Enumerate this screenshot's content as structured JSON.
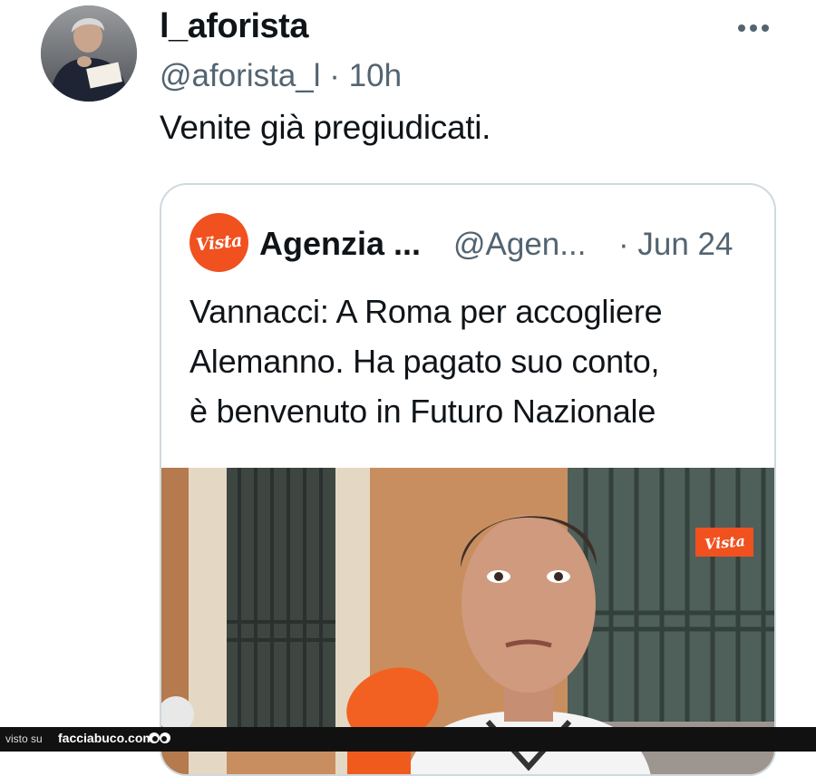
{
  "tweet": {
    "author_name": "l_aforista",
    "author_handle": "@aforista_l",
    "separator": "·",
    "time": "10h",
    "text": "Venite già pregiudicati."
  },
  "quoted_tweet": {
    "avatar_label": "Vista",
    "author_name": "Agenzia ...",
    "author_handle": "@Agen...",
    "date": "· Jun 24",
    "text_lines": [
      "Vannacci: A Roma per accogliere",
      "Alemanno. Ha pagato suo conto,",
      "è benvenuto in Futuro Nazionale"
    ],
    "media_watermark": "Vista"
  },
  "footer": {
    "prefix": "visto su",
    "brand": "facciabuco.com"
  },
  "icons": {
    "more": "more-horizontal-icon",
    "footer_logo": "eyes-icon"
  },
  "colors": {
    "secondary_text": "#536471",
    "card_border": "#cfd9de",
    "vista_orange": "#f0511f",
    "footer_bg": "#111111"
  }
}
